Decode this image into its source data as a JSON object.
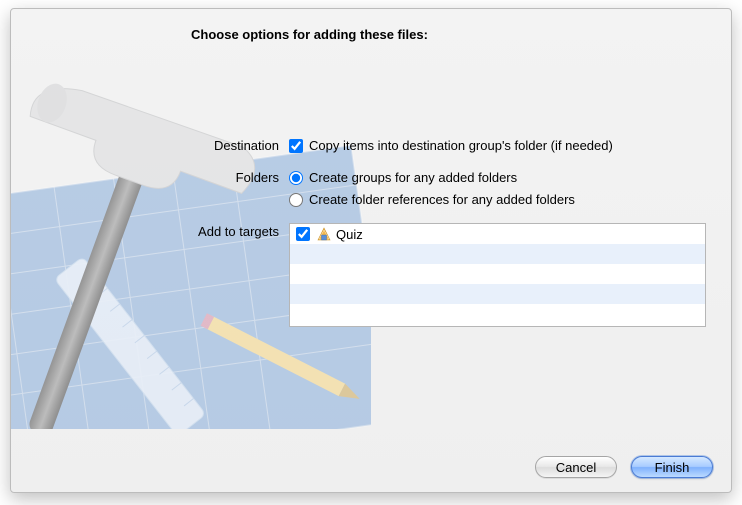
{
  "title": "Choose options for adding these files:",
  "destination": {
    "label": "Destination",
    "copy_items": {
      "label": "Copy items into destination group's folder (if needed)",
      "checked": true
    }
  },
  "folders": {
    "label": "Folders",
    "create_groups": {
      "label": "Create groups for any added folders",
      "selected": true
    },
    "create_refs": {
      "label": "Create folder references for any added folders",
      "selected": false
    }
  },
  "targets": {
    "label": "Add to targets",
    "items": [
      {
        "name": "Quiz",
        "checked": true
      }
    ]
  },
  "buttons": {
    "cancel": "Cancel",
    "finish": "Finish"
  }
}
